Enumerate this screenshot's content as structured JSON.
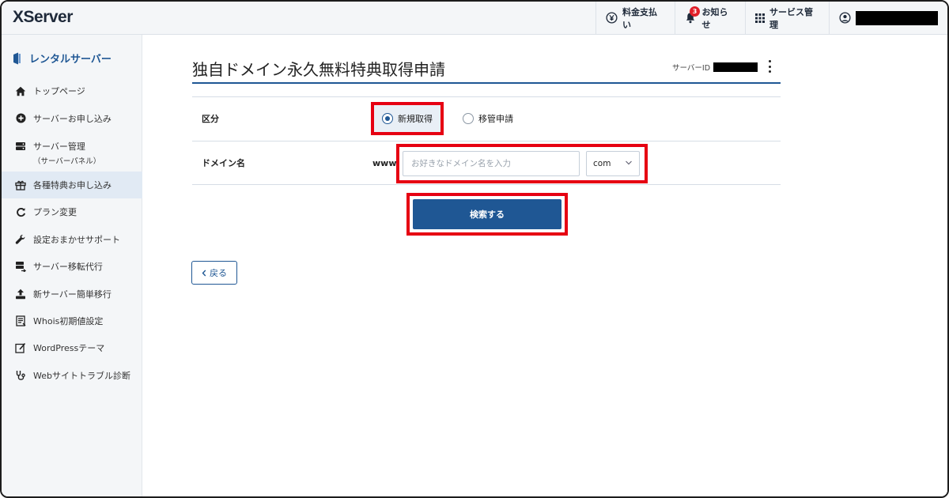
{
  "header": {
    "logo": "XServer",
    "billing_label": "料金支払い",
    "news_label": "お知らせ",
    "news_badge": "3",
    "services_label": "サービス管理"
  },
  "sidebar": {
    "title": "レンタルサーバー",
    "items": [
      {
        "label": "トップページ",
        "icon": "home-icon"
      },
      {
        "label": "サーバーお申し込み",
        "icon": "plus-circle-icon"
      },
      {
        "label": "サーバー管理",
        "sub": "（サーバーパネル）",
        "icon": "server-icon"
      },
      {
        "label": "各種特典お申し込み",
        "icon": "gift-icon",
        "active": true
      },
      {
        "label": "プラン変更",
        "icon": "refresh-icon"
      },
      {
        "label": "設定おまかせサポート",
        "icon": "wrench-icon"
      },
      {
        "label": "サーバー移転代行",
        "icon": "server-move-icon"
      },
      {
        "label": "新サーバー簡単移行",
        "icon": "upload-icon"
      },
      {
        "label": "Whois初期値設定",
        "icon": "document-icon"
      },
      {
        "label": "WordPressテーマ",
        "icon": "edit-icon"
      },
      {
        "label": "Webサイトトラブル診断",
        "icon": "stethoscope-icon"
      }
    ]
  },
  "main": {
    "page_title": "独自ドメイン永久無料特典取得申請",
    "server_id_label": "サーバーID",
    "form": {
      "category_label": "区分",
      "options": [
        "新規取得",
        "移管申請"
      ],
      "selected_option": "新規取得",
      "domain_label": "ドメイン名",
      "www_prefix": "www.",
      "domain_placeholder": "お好きなドメイン名を入力",
      "domain_value": "",
      "tld_value": "com"
    },
    "search_button": "検索する",
    "back_button": "戻る"
  },
  "colors": {
    "accent": "#1f5794",
    "highlight": "#e60012",
    "badge": "#e0202a"
  }
}
